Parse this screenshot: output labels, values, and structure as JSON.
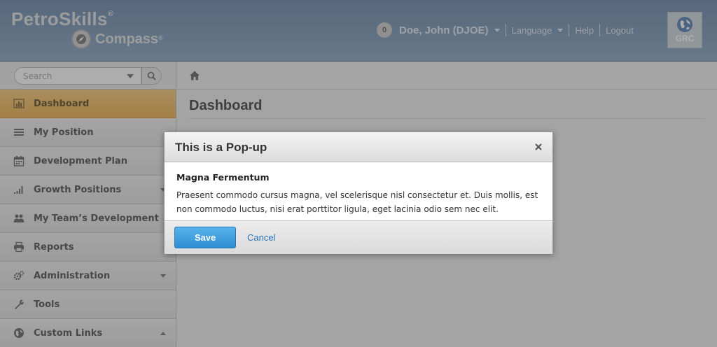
{
  "header": {
    "logo_main": "PetroSkills",
    "logo_reg": "®",
    "logo_sub": "Compass",
    "logo_sub_reg": "®",
    "notification_count": "0",
    "user_name": "Doe, John (DJOE)",
    "language_label": "Language",
    "help_label": "Help",
    "logout_label": "Logout",
    "grc_label": "GRC"
  },
  "sidebar": {
    "search_placeholder": "Search",
    "items": [
      {
        "label": "Dashboard",
        "icon": "bar-chart-icon",
        "active": true
      },
      {
        "label": "My Position",
        "icon": "list-icon"
      },
      {
        "label": "Development Plan",
        "icon": "calendar-icon"
      },
      {
        "label": "Growth Positions",
        "icon": "signal-bars-icon",
        "caret": "down"
      },
      {
        "label": "My Team’s Development",
        "icon": "team-icon"
      },
      {
        "label": "Reports",
        "icon": "printer-icon"
      },
      {
        "label": "Administration",
        "icon": "gears-icon",
        "caret": "down"
      },
      {
        "label": "Tools",
        "icon": "wrench-icon"
      },
      {
        "label": "Custom Links",
        "icon": "globe-icon",
        "caret": "up"
      }
    ]
  },
  "main": {
    "page_title": "Dashboard"
  },
  "modal": {
    "title": "This is a Pop-up",
    "body_heading": "Magna Fermentum",
    "body_text": "Praesent commodo cursus magna, vel scelerisque nisl consectetur et. Duis mollis, est non commodo luctus, nisi erat porttitor ligula, eget lacinia odio sem nec elit.",
    "save_label": "Save",
    "cancel_label": "Cancel"
  },
  "colors": {
    "header_bg": "#8aa3be",
    "active_nav": "#f3c474",
    "save_button": "#3a9ad9",
    "cancel_link": "#2a74b8"
  }
}
